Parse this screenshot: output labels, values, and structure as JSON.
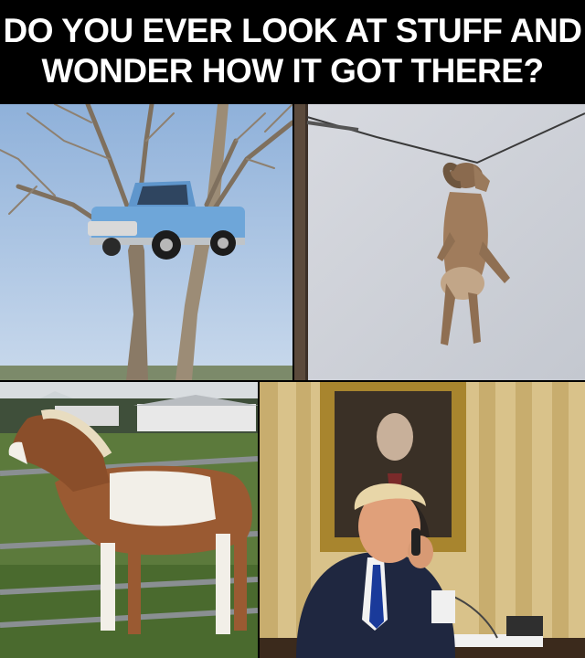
{
  "caption": {
    "line1": "DO YOU EVER LOOK AT STUFF AND",
    "line2": "WONDER HOW IT GOT THERE?"
  },
  "panels": [
    {
      "subject": "truck-in-tree-photo"
    },
    {
      "subject": "ram-on-power-line-photo"
    },
    {
      "subject": "horse-over-fence-photo"
    },
    {
      "subject": "man-on-phone-photo"
    }
  ],
  "colors": {
    "background": "#000000",
    "caption_text": "#ffffff",
    "truck_body": "#6ea6d9",
    "sky": "#a9c4e4"
  }
}
